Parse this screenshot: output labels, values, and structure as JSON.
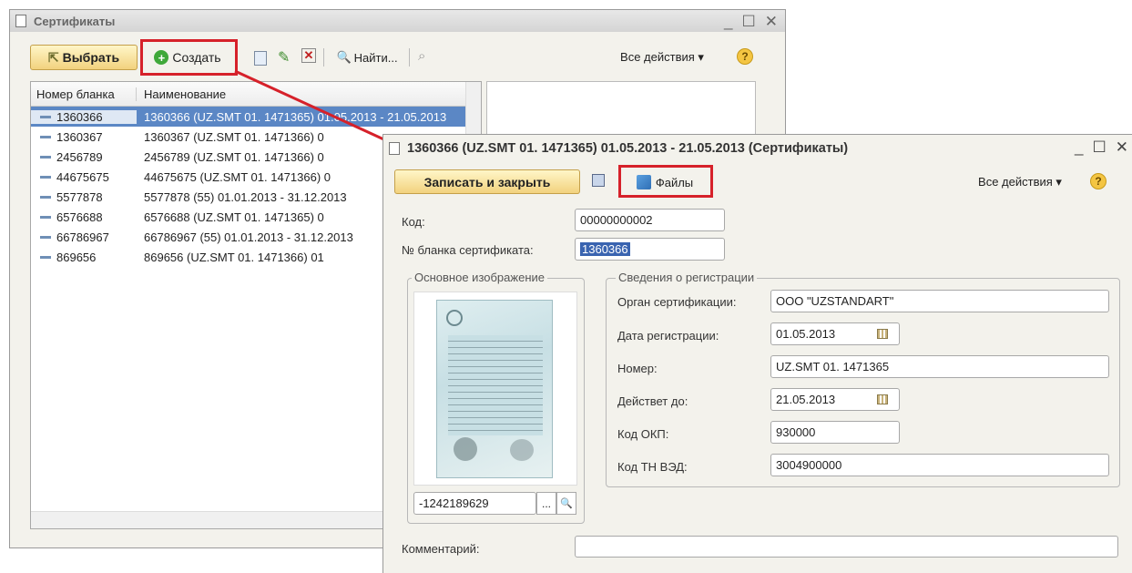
{
  "list_window": {
    "title": "Сертификаты",
    "toolbar": {
      "select_label": "Выбрать",
      "create_label": "Создать",
      "find_label": "Найти...",
      "all_actions_label": "Все действия ▾",
      "help_label": "?"
    },
    "columns": [
      "Номер бланка",
      "Наименование"
    ],
    "rows": [
      {
        "number": "1360366",
        "name": "1360366 (UZ.SMT 01.  1471365) 01.05.2013 - 21.05.2013",
        "selected": true
      },
      {
        "number": "1360367",
        "name": "1360367 (UZ.SMT 01.  1471366) 0"
      },
      {
        "number": "2456789",
        "name": "2456789 (UZ.SMT 01.  1471366) 0"
      },
      {
        "number": "44675675",
        "name": "44675675 (UZ.SMT 01.  1471366) 0"
      },
      {
        "number": "5577878",
        "name": "5577878 (55) 01.01.2013 - 31.12.2013"
      },
      {
        "number": "6576688",
        "name": "6576688 (UZ.SMT 01.  1471365) 0"
      },
      {
        "number": "66786967",
        "name": "66786967 (55) 01.01.2013 - 31.12.2013"
      },
      {
        "number": "869656",
        "name": "869656 (UZ.SMT 01.  1471366) 01"
      }
    ]
  },
  "form_window": {
    "title": "1360366 (UZ.SMT 01.  1471365) 01.05.2013 - 21.05.2013 (Сертификаты)",
    "toolbar": {
      "save_close_label": "Записать и закрыть",
      "files_label": "Файлы",
      "all_actions_label": "Все действия ▾",
      "help_label": "?"
    },
    "code_label": "Код:",
    "code_value": "00000000002",
    "blank_label": "№ бланка сертификата:",
    "blank_value": "1360366",
    "image_group_title": "Основное изображение",
    "image_id_value": "-1242189629",
    "image_picker_label": "...",
    "reg_group_title": "Сведения о регистрации",
    "organ_label": "Орган сертификации:",
    "organ_value": "ООО \"UZSTANDART\"",
    "reg_date_label": "Дата регистрации:",
    "reg_date_value": "01.05.2013",
    "number_label": "Номер:",
    "number_value": "UZ.SMT 01.  1471365",
    "valid_until_label": "Действет до:",
    "valid_until_value": "21.05.2013",
    "okp_label": "Код ОКП:",
    "okp_value": "930000",
    "tnved_label": "Код ТН ВЭД:",
    "tnved_value": "3004900000",
    "comment_label": "Комментарий:",
    "comment_value": ""
  },
  "colors": {
    "selection": "#5b87c5",
    "highlight_box": "#d6212a",
    "window_bg": "#f3f2ec",
    "button_yellow": "#f2d27e"
  }
}
